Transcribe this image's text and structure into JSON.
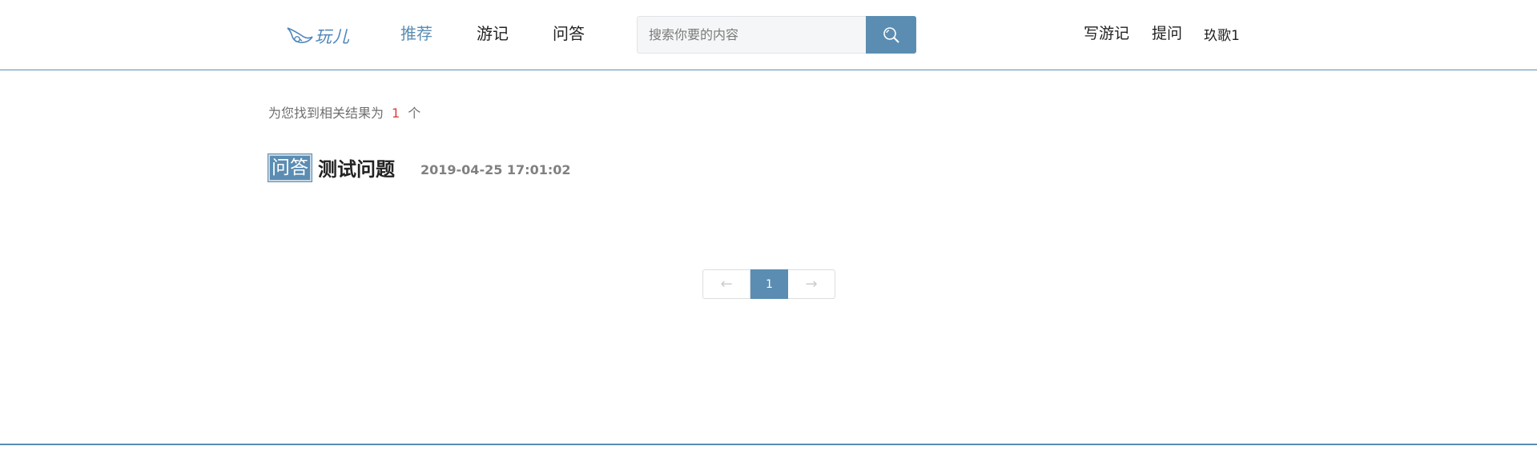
{
  "header": {
    "logo_text": "玩儿",
    "nav": [
      {
        "label": "推荐",
        "active": true
      },
      {
        "label": "游记",
        "active": false
      },
      {
        "label": "问答",
        "active": false
      }
    ],
    "search": {
      "placeholder": "搜索你要的内容",
      "value": "",
      "icon": "search-icon"
    },
    "links": {
      "write": "写游记",
      "ask": "提问",
      "user": "玖歌1"
    }
  },
  "results": {
    "prefix": "为您找到相关结果为",
    "count": "1",
    "suffix": "个",
    "items": [
      {
        "tag": "问答",
        "title": "测试问题",
        "time": "2019-04-25 17:01:02"
      }
    ]
  },
  "pagination": {
    "prev": "←",
    "current": "1",
    "next": "→"
  },
  "colors": {
    "accent": "#5b8db3",
    "count": "#e03c3c"
  }
}
